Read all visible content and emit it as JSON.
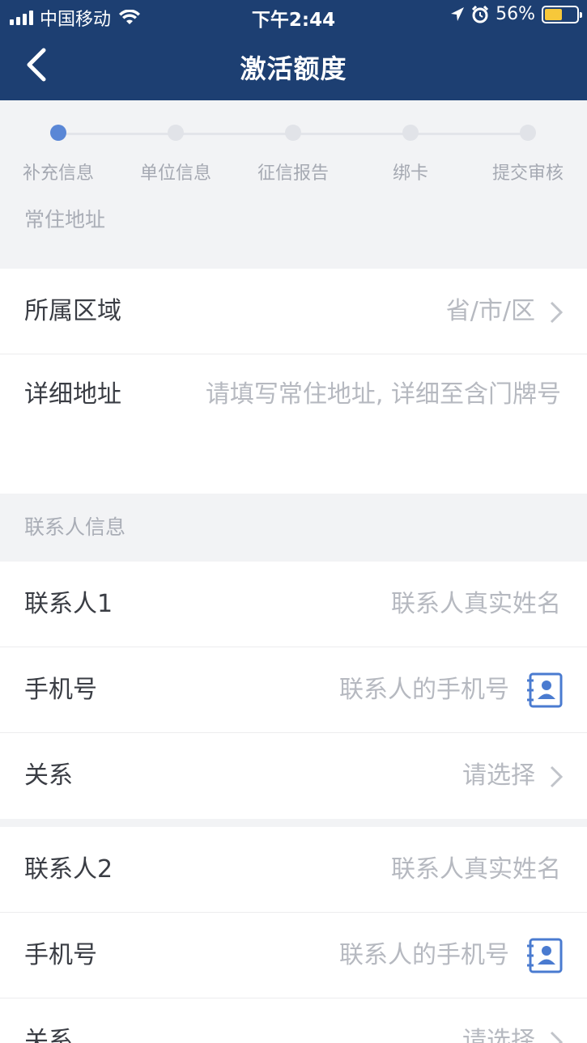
{
  "status_bar": {
    "carrier": "中国移动",
    "time": "下午2:44",
    "battery": "56%"
  },
  "nav": {
    "title": "激活额度"
  },
  "steps": [
    {
      "label": "补充信息",
      "active": true
    },
    {
      "label": "单位信息",
      "active": false
    },
    {
      "label": "征信报告",
      "active": false
    },
    {
      "label": "绑卡",
      "active": false
    },
    {
      "label": "提交审核",
      "active": false
    }
  ],
  "address_section": {
    "title": "常住地址",
    "region_label": "所属区域",
    "region_placeholder": "省/市/区",
    "detail_label": "详细地址",
    "detail_placeholder": "请填写常住地址, 详细至含门牌号"
  },
  "contact_section": {
    "title": "联系人信息",
    "contacts": [
      {
        "name_label": "联系人1",
        "name_placeholder": "联系人真实姓名",
        "phone_label": "手机号",
        "phone_placeholder": "联系人的手机号",
        "relation_label": "关系",
        "relation_placeholder": "请选择"
      },
      {
        "name_label": "联系人2",
        "name_placeholder": "联系人真实姓名",
        "phone_label": "手机号",
        "phone_placeholder": "联系人的手机号",
        "relation_label": "关系",
        "relation_placeholder": "请选择"
      }
    ]
  },
  "colors": {
    "header": "#1d3f72",
    "accent": "#5a87d6",
    "placeholder": "#b6b9c0"
  }
}
